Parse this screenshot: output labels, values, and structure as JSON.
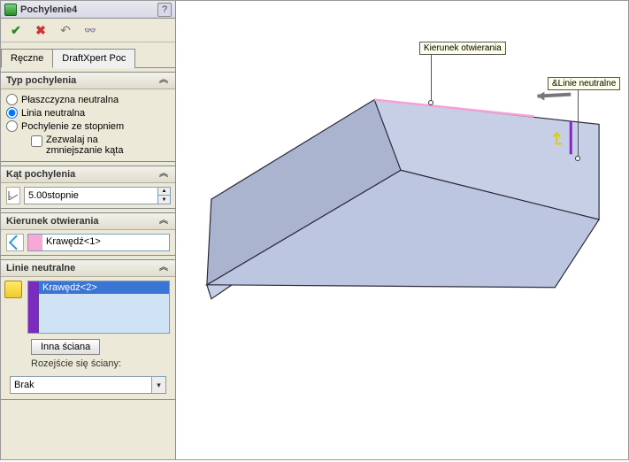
{
  "title": "Pochylenie4",
  "tabs": {
    "manual": "Ręczne",
    "draftxpert": "DraftXpert Poc"
  },
  "sec_type": {
    "title": "Typ pochylenia",
    "opt_plane": "Płaszczyzna neutralna",
    "opt_line": "Linia neutralna",
    "opt_step": "Pochylenie ze stopniem",
    "chk_allow": "Zezwalaj na\nzmniejszanie kąta"
  },
  "sec_angle": {
    "title": "Kąt pochylenia",
    "value": "5.00stopnie"
  },
  "sec_dir": {
    "title": "Kierunek otwierania",
    "value": "Krawędź<1>"
  },
  "sec_lines": {
    "title": "Linie neutralne",
    "item": "Krawędź<2>",
    "btn_face": "Inna ściana",
    "label_fan": "Rozejście się ściany:",
    "combo_val": "Brak"
  },
  "viewport": {
    "callout_dir": "Kierunek otwierania",
    "callout_lines": "&Linie neutralne"
  }
}
